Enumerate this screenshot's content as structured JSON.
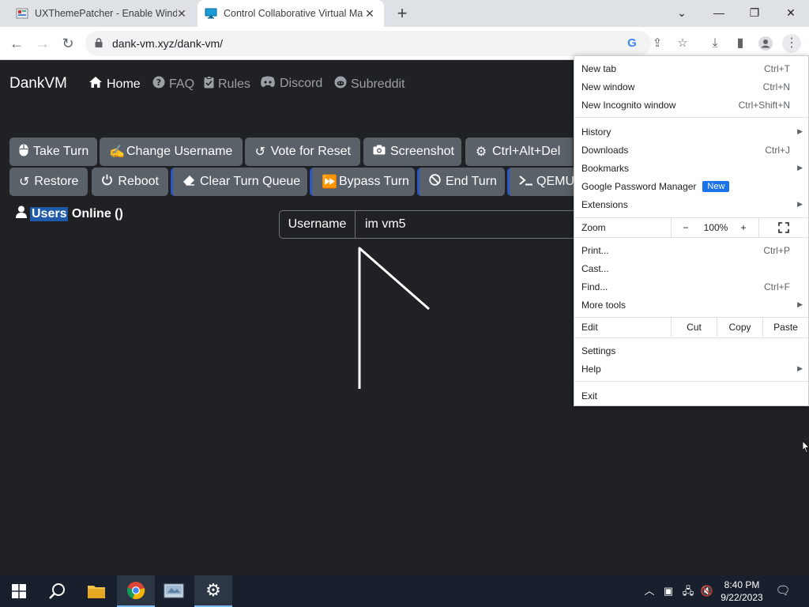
{
  "browser": {
    "tabs": [
      {
        "title": "UXThemePatcher - Enable Windo",
        "close": "✕"
      },
      {
        "title": "Control Collaborative Virtual Ma",
        "close": "✕"
      }
    ],
    "new_tab": "+",
    "window_controls": {
      "menu": "⌄",
      "minimize": "—",
      "restore": "❐",
      "close": "✕"
    },
    "url": "dank-vm.xyz/dank-vm/"
  },
  "site": {
    "brand": "DankVM",
    "nav": [
      {
        "label": "Home",
        "icon": "home-icon"
      },
      {
        "label": "FAQ",
        "icon": "question-icon"
      },
      {
        "label": "Rules",
        "icon": "clipboard-icon"
      },
      {
        "label": "Discord",
        "icon": "discord-icon"
      },
      {
        "label": "Subreddit",
        "icon": "reddit-icon"
      }
    ],
    "buttons_row1": [
      {
        "label": "Take Turn",
        "icon": "mouse-icon"
      },
      {
        "label": "Change Username",
        "icon": "signature-icon"
      },
      {
        "label": "Vote for Reset",
        "icon": "undo-icon"
      },
      {
        "label": "Screenshot",
        "icon": "camera-icon"
      },
      {
        "label": "Ctrl+Alt+Del",
        "icon": "gear-icon"
      }
    ],
    "buttons_row2": [
      {
        "label": "Restore",
        "icon": "restore-icon"
      },
      {
        "label": "Reboot",
        "icon": "power-icon"
      },
      {
        "label": "Clear Turn Queue",
        "icon": "eraser-icon"
      },
      {
        "label": "Bypass Turn",
        "icon": "forward-icon"
      },
      {
        "label": "End Turn",
        "icon": "ban-icon"
      },
      {
        "label": "QEMU",
        "icon": "terminal-icon"
      }
    ],
    "users_online": {
      "selected": "Users",
      "rest": " Online ()"
    },
    "username": {
      "label": "Username",
      "value": "im vm5"
    }
  },
  "chrome_menu": {
    "items": [
      {
        "label": "New tab",
        "shortcut": "Ctrl+T"
      },
      {
        "label": "New window",
        "shortcut": "Ctrl+N"
      },
      {
        "label": "New Incognito window",
        "shortcut": "Ctrl+Shift+N"
      },
      {
        "label": "History",
        "submenu": true
      },
      {
        "label": "Downloads",
        "shortcut": "Ctrl+J"
      },
      {
        "label": "Bookmarks",
        "submenu": true
      },
      {
        "label": "Google Password Manager",
        "badge": "New"
      },
      {
        "label": "Extensions",
        "submenu": true
      },
      {
        "label": "Print...",
        "shortcut": "Ctrl+P"
      },
      {
        "label": "Cast..."
      },
      {
        "label": "Find...",
        "shortcut": "Ctrl+F"
      },
      {
        "label": "More tools",
        "submenu": true
      },
      {
        "label": "Settings"
      },
      {
        "label": "Help",
        "submenu": true
      },
      {
        "label": "Exit"
      }
    ],
    "zoom": {
      "label": "Zoom",
      "minus": "−",
      "level": "100%",
      "plus": "+"
    },
    "edit": {
      "label": "Edit",
      "cut": "Cut",
      "copy": "Copy",
      "paste": "Paste"
    }
  },
  "taskbar": {
    "clock_time": "8:40 PM",
    "clock_date": "9/22/2023"
  },
  "colors": {
    "page_bg": "#1f2124",
    "button_bg": "#5a6168",
    "accent_blue": "#1a73e8"
  }
}
